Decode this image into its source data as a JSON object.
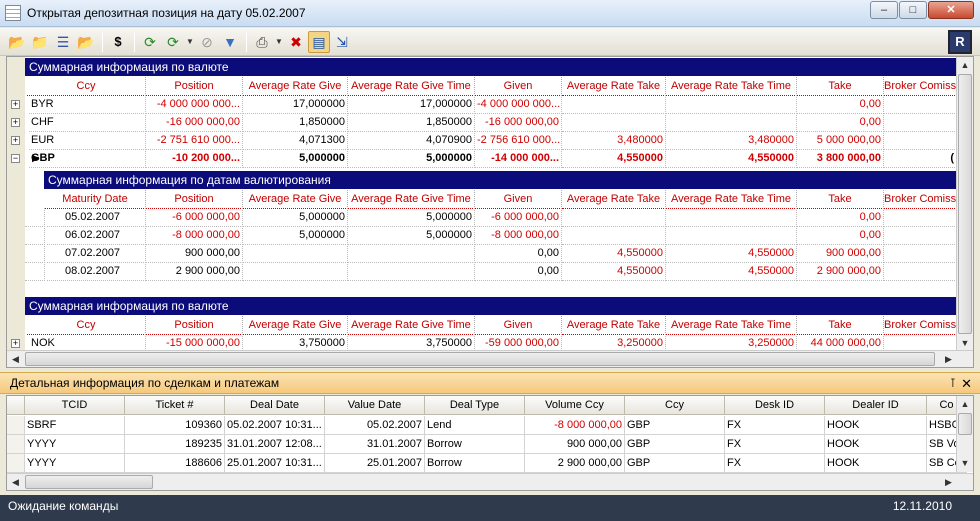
{
  "window": {
    "title": "Открытая депозитная позиция на дату 05.02.2007"
  },
  "toolbar": {
    "icons": [
      "open-folder-icon",
      "folder-icon",
      "list-icon",
      "new-folder-icon",
      "dollar-icon",
      "refresh-icon",
      "refresh-dropdown-icon",
      "cancel-icon",
      "filter-icon",
      "print-icon",
      "clear-filter-icon",
      "group-icon",
      "export-icon"
    ],
    "dollar": "$",
    "logo": "R"
  },
  "summary1": {
    "band": "Суммарная информация по валюте",
    "columns": [
      "Ccy",
      "Position",
      "Average Rate Give",
      "Average Rate Give Time",
      "Given",
      "Average Rate Take",
      "Average Rate Take Time",
      "Take",
      "Broker Comiss"
    ],
    "rows": [
      [
        "BYR",
        "-4 000 000 000...",
        "17,000000",
        "17,000000",
        "-4 000 000 000...",
        "",
        "",
        "0,00",
        ""
      ],
      [
        "CHF",
        "-16 000 000,00",
        "1,850000",
        "1,850000",
        "-16 000 000,00",
        "",
        "",
        "0,00",
        ""
      ],
      [
        "EUR",
        "-2 751 610 000...",
        "4,071300",
        "4,070900",
        "-2 756 610 000...",
        "3,480000",
        "3,480000",
        "5 000 000,00",
        ""
      ],
      [
        "GBP",
        "-10 200 000...",
        "5,000000",
        "5,000000",
        "-14 000 000...",
        "4,550000",
        "4,550000",
        "3 800 000,00",
        "("
      ]
    ]
  },
  "detail": {
    "band": "Суммарная информация по датам валютирования",
    "columns": [
      "Maturity Date",
      "Position",
      "Average Rate Give",
      "Average Rate Give Time",
      "Given",
      "Average Rate Take",
      "Average Rate Take Time",
      "Take",
      "Broker Comiss"
    ],
    "rows": [
      [
        "05.02.2007",
        "-6 000 000,00",
        "5,000000",
        "5,000000",
        "-6 000 000,00",
        "",
        "",
        "0,00",
        ""
      ],
      [
        "06.02.2007",
        "-8 000 000,00",
        "5,000000",
        "5,000000",
        "-8 000 000,00",
        "",
        "",
        "0,00",
        ""
      ],
      [
        "07.02.2007",
        "900 000,00",
        "",
        "",
        "0,00",
        "4,550000",
        "4,550000",
        "900 000,00",
        ""
      ],
      [
        "08.02.2007",
        "2 900 000,00",
        "",
        "",
        "0,00",
        "4,550000",
        "4,550000",
        "2 900 000,00",
        ""
      ]
    ]
  },
  "summary2": {
    "band": "Суммарная информация по валюте",
    "columns": [
      "Ccy",
      "Position",
      "Average Rate Give",
      "Average Rate Give Time",
      "Given",
      "Average Rate Take",
      "Average Rate Take Time",
      "Take",
      "Broker Comiss"
    ],
    "rows": [
      [
        "NOK",
        "-15 000 000,00",
        "3,750000",
        "3,750000",
        "-59 000 000,00",
        "3,250000",
        "3,250000",
        "44 000 000,00",
        ""
      ]
    ]
  },
  "panel": {
    "title": "Детальная информация по сделкам и платежам",
    "pin": "ᵖ",
    "close": "✕"
  },
  "deals": {
    "columns": [
      "TCID",
      "Ticket #",
      "Deal Date",
      "Value Date",
      "Deal Type",
      "Volume Ccy",
      "Ccy",
      "Desk ID",
      "Dealer ID",
      "Co"
    ],
    "rows": [
      [
        "SBRF",
        "109360",
        "05.02.2007 10:31...",
        "05.02.2007",
        "Lend",
        "-8 000 000,00",
        "GBP",
        "FX",
        "HOOK",
        "HSBC"
      ],
      [
        "YYYY",
        "189235",
        "31.01.2007 12:08...",
        "31.01.2007",
        "Borrow",
        "900 000,00",
        "GBP",
        "FX",
        "HOOK",
        "SB Vo"
      ],
      [
        "YYYY",
        "188606",
        "25.01.2007 10:31...",
        "25.01.2007",
        "Borrow",
        "2 900 000,00",
        "GBP",
        "FX",
        "HOOK",
        "SB Ce"
      ]
    ]
  },
  "status": {
    "text": "Ожидание команды",
    "date": "12.11.2010"
  },
  "colors": {
    "band": "#0b0b7a",
    "negative": "#d00000",
    "panel": "#f6c97c",
    "status": "#2f3b4d"
  }
}
